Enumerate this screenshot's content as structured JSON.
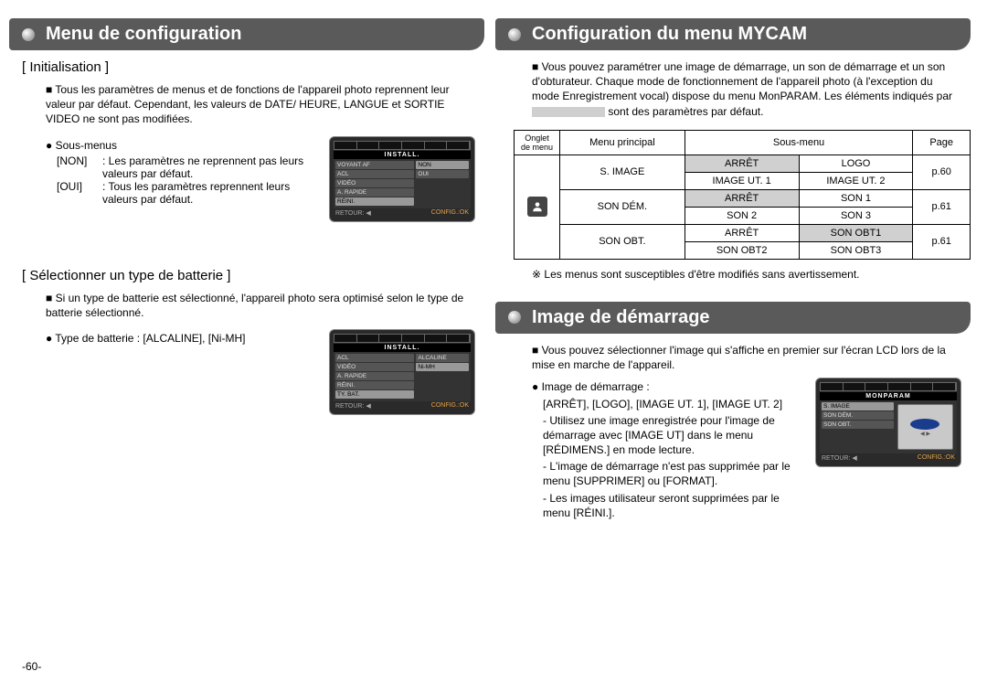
{
  "left": {
    "ribbon": "Menu de configuration",
    "init": {
      "title": "[ Initialisation ]",
      "p1": "Tous les paramètres de menus et de fonctions de l'appareil photo reprennent leur valeur par défaut. Cependant, les valeurs de DATE/ HEURE, LANGUE et SORTIE VIDEO ne sont pas modifiées.",
      "sub_lbl": "Sous-menus",
      "non_k": "[NON]",
      "non_v": ": Les paramètres ne reprennent pas leurs valeurs par défaut.",
      "oui_k": "[OUI]",
      "oui_v": ": Tous les paramètres reprennent leurs valeurs par défaut.",
      "cam": {
        "title": "INSTALL.",
        "items": [
          "VOYANT AF",
          "ACL",
          "VIDÉO",
          "A. RAPIDE",
          "RÉINI."
        ],
        "vals": [
          "NON",
          "OUI"
        ],
        "foot_l": "RETOUR: ◀",
        "foot_r": "CONFIG.:OK"
      }
    },
    "bat": {
      "title": "[ Sélectionner un type de batterie ]",
      "p1": "Si un type de batterie est sélectionné, l'appareil photo sera optimisé selon le type de batterie sélectionné.",
      "p2": "Type de batterie : [ALCALINE], [Ni-MH]",
      "cam": {
        "title": "INSTALL.",
        "items": [
          "ACL",
          "VIDÉO",
          "A. RAPIDE",
          "RÉINI.",
          "TY. BAT."
        ],
        "vals": [
          "ALCALINE",
          "Ni-MH"
        ],
        "foot_l": "RETOUR: ◀",
        "foot_r": "CONFIG.:OK"
      }
    }
  },
  "right": {
    "ribbon1": "Configuration du menu MYCAM",
    "intro": "Vous pouvez paramétrer une image de démarrage, un son de démarrage et un son d'obturateur. Chaque mode de fonctionnement de l'appareil photo (à l'exception du mode Enregistrement vocal) dispose du menu MonPARAM. Les éléments indiqués par ",
    "intro_tail": " sont des paramètres par défaut.",
    "table": {
      "h": [
        "Onglet de menu",
        "Menu principal",
        "Sous-menu",
        "Page"
      ],
      "r": [
        {
          "m": "S. IMAGE",
          "s": [
            "ARRÊT",
            "LOGO",
            "IMAGE UT. 1",
            "IMAGE UT. 2"
          ],
          "p": "p.60"
        },
        {
          "m": "SON DÉM.",
          "s": [
            "ARRÊT",
            "SON 1",
            "SON 2",
            "SON 3"
          ],
          "p": "p.61"
        },
        {
          "m": "SON OBT.",
          "s": [
            "ARRÊT",
            "SON OBT1",
            "SON OBT2",
            "SON OBT3"
          ],
          "p": "p.61"
        }
      ]
    },
    "foot1": "Les menus sont susceptibles d'être modifiés sans avertissement.",
    "ribbon2": "Image de démarrage",
    "startimg": {
      "p1": "Vous pouvez sélectionner l'image qui s'affiche en premier sur l'écran LCD lors de la mise en marche de l'appareil.",
      "lbl": "Image de démarrage :",
      "opts": "[ARRÊT], [LOGO], [IMAGE UT. 1], [IMAGE UT. 2]",
      "b1": "- Utilisez une image enregistrée pour l'image de démarrage avec [IMAGE UT] dans le menu [RÉDIMENS.] en mode lecture.",
      "b2": "- L'image de démarrage n'est pas supprimée par le menu [SUPPRIMER] ou [FORMAT].",
      "b3": "- Les images utilisateur seront supprimées par le menu [RÉINI.].",
      "cam": {
        "title": "MONPARAM",
        "items": [
          "S. IMAGE",
          "SON DÉM.",
          "SON OBT."
        ],
        "foot_l": "RETOUR: ◀",
        "foot_r": "CONFIG.:OK"
      }
    }
  },
  "pagenum": "-60-"
}
